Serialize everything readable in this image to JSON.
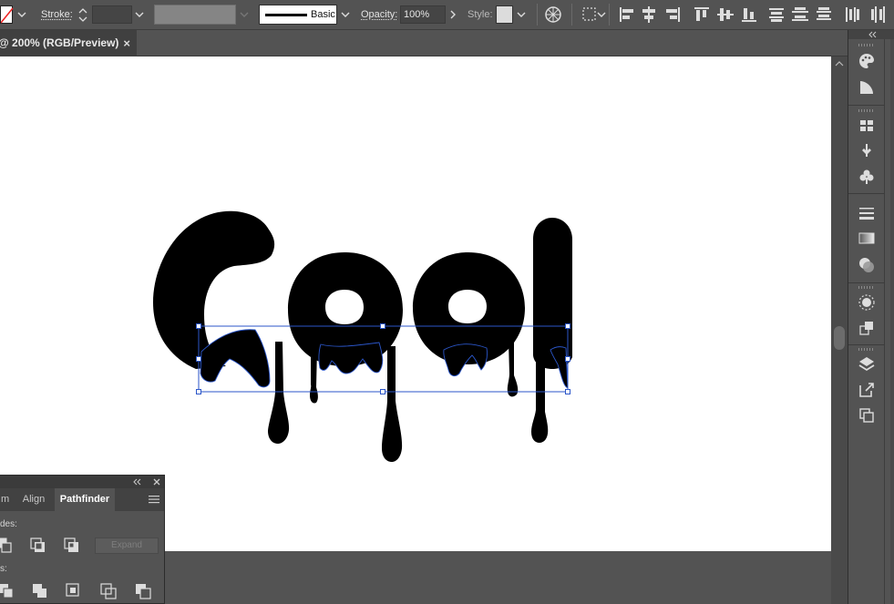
{
  "control_bar": {
    "stroke_label": "Stroke:",
    "stroke_weight": "",
    "brush_label": "Basic",
    "opacity_label": "Opacity:",
    "opacity_value": "100%",
    "style_label": "Style:"
  },
  "document": {
    "tab_title": "@ 200% (RGB/Preview)",
    "close_glyph": "×"
  },
  "artwork": {
    "word": "Cool",
    "fill": "#000000",
    "selection_color": "#2b56c9"
  },
  "pathfinder_panel": {
    "tabs": [
      "m",
      "Align",
      "Pathfinder"
    ],
    "active_tab": "Pathfinder",
    "shape_modes_label": "des:",
    "pathfinders_label": "s:",
    "expand_label": "Expand"
  },
  "dock": {
    "icons": [
      "color-icon",
      "color-guide-icon",
      "swatches-icon",
      "brushes-icon",
      "symbols-icon",
      "stroke-icon",
      "gradient-icon",
      "transparency-icon",
      "appearance-icon",
      "graphic-styles-icon",
      "layers-icon",
      "asset-export-icon",
      "artboards-icon"
    ]
  },
  "colors": {
    "ui_bg": "#535353",
    "panel_dark": "#424242",
    "artboard": "#ffffff"
  }
}
